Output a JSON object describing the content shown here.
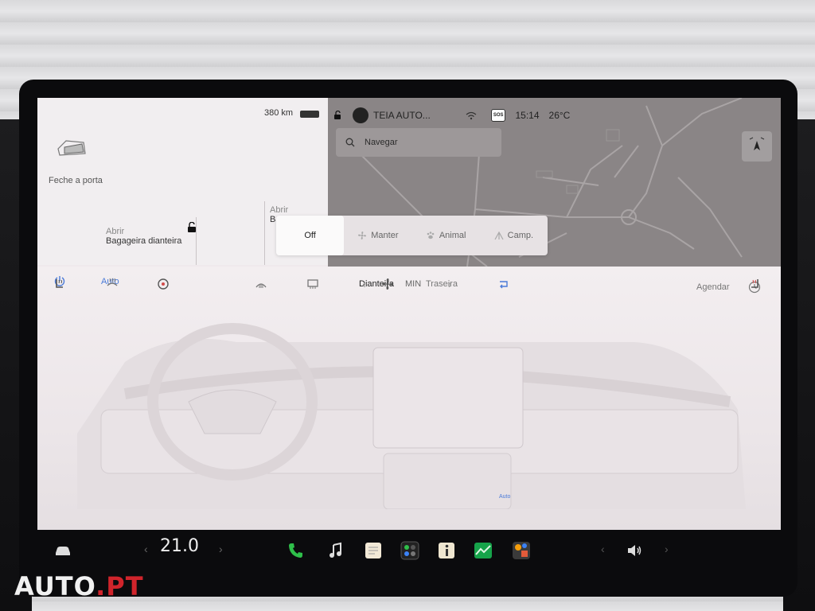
{
  "status": {
    "range": "380 km",
    "profile": "TEIA AUTO...",
    "sos": "SOS",
    "time": "15:14",
    "temperature": "26°C"
  },
  "car_panel": {
    "door_label": "Feche a porta",
    "front_trunk_action": "Abrir",
    "front_trunk_name": "Bagageira dianteira",
    "rear_trunk_action": "Abrir",
    "rear_trunk_name": "Ba"
  },
  "map": {
    "search_placeholder": "Navegar"
  },
  "climate_modes": [
    {
      "label": "Off",
      "selected": true
    },
    {
      "label": "Manter",
      "selected": false
    },
    {
      "label": "Animal",
      "selected": false
    },
    {
      "label": "Camp.",
      "selected": false
    }
  ],
  "climate": {
    "auto_label": "Auto",
    "tab_front": "Dianteira",
    "tab_rear": "Traseira",
    "schedule_label": "Agendar",
    "fan_speed": "MIN",
    "recirc_auto_label": "Auto"
  },
  "taskbar": {
    "cabin_temp": "21.0",
    "icons": [
      "car-icon",
      "phone-icon",
      "music-icon",
      "notes-icon",
      "apps-icon",
      "info-icon",
      "energy-icon",
      "games-icon",
      "volume-icon"
    ]
  },
  "watermark": {
    "brand_main": "AUTO",
    "brand_suffix": ".PT"
  },
  "colors": {
    "accent_blue": "#4a7ad8",
    "map_gray": "#8a8586",
    "screen_bg": "#efe9ec",
    "taskbar_bg": "#0b0b0d",
    "brand_red": "#d0242b"
  }
}
